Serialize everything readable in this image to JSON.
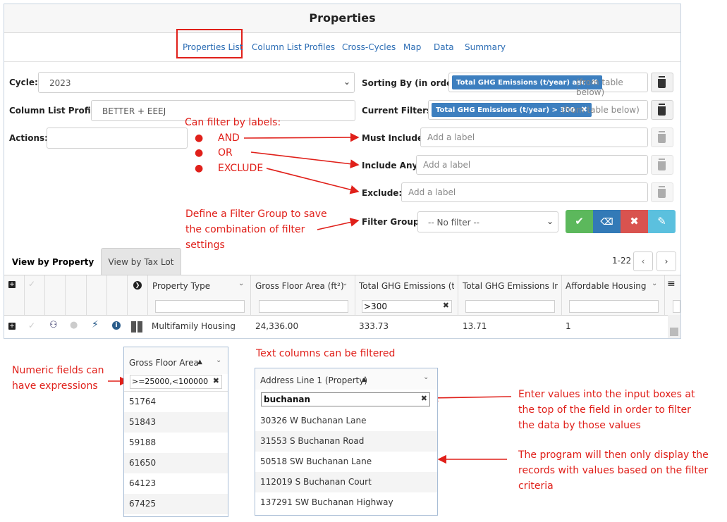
{
  "title": "Properties",
  "nav": {
    "tabs": [
      "Properties List",
      "Column List Profiles",
      "Cross-Cycles",
      "Map",
      "Data",
      "Summary"
    ]
  },
  "form": {
    "cycle_label": "Cycle:",
    "cycle_value": "2023",
    "column_profile_label": "Column List Profile:",
    "column_profile_value": "BETTER + EEEJ",
    "actions_label": "Actions:",
    "sorting_label": "Sorting By (in order):",
    "sorting_chip": "Total GHG Emissions (t/year) asc",
    "sorting_hint": "(from table below)",
    "filters_label": "Current Filters:",
    "filters_chip": "Total GHG Emissions (t/year) > 300",
    "filters_hint": "(from table below)",
    "must_include_label": "Must Include:",
    "include_any_label": "Include Any:",
    "exclude_label": "Exclude:",
    "label_placeholder": "Add a label",
    "filter_group_label": "Filter Group:",
    "filter_group_value": "-- No filter --"
  },
  "annotations": {
    "labels_title": "Can filter by labels:",
    "and": "AND",
    "or": "OR",
    "exclude": "EXCLUDE",
    "filter_group_line1": "Define a Filter Group to save",
    "filter_group_line2": "the combination of filter",
    "filter_group_line3": "settings",
    "text_columns": "Text columns can be filtered",
    "numeric_line1": "Numeric fields can",
    "numeric_line2": "have expressions",
    "enter_line1": "Enter values into the input boxes at",
    "enter_line2": "the top of the field in order to filter",
    "enter_line3": "the data by those values",
    "program_line1": "The program will then only display the",
    "program_line2": "records with values based on the filter",
    "program_line3": "criteria"
  },
  "view_tabs": [
    "View by Property",
    "View by Tax Lot"
  ],
  "pagination": "1-22",
  "grid": {
    "columns": [
      "Property Type",
      "Gross Floor Area (ft²)",
      "Total GHG Emissions (t:",
      "Total GHG Emissions In:",
      "Affordable Housing"
    ],
    "ghg_filter": ">300",
    "row": [
      "Multifamily Housing",
      "24,336.00",
      "333.73",
      "13.71",
      "1"
    ]
  },
  "popup_area": {
    "header": "Gross Floor Area",
    "filter": ">=25000,<100000",
    "values": [
      "51764",
      "51843",
      "59188",
      "61650",
      "64123",
      "67425"
    ]
  },
  "popup_address": {
    "header": "Address Line 1 (Property)",
    "filter": "buchanan",
    "values": [
      "30326 W Buchanan Lane",
      "31553 S Buchanan Road",
      "50518 SW Buchanan Lane",
      "112019 S Buchanan Court",
      "137291 SW Buchanan Highway"
    ]
  },
  "colors": {
    "accent_red": "#e0201a",
    "chip_blue": "#3d7fbf",
    "link_blue": "#2a6cb4",
    "btn_green": "#5cb85c",
    "btn_blue": "#337ab7",
    "btn_red": "#d9534f",
    "btn_cyan": "#5bc0de"
  }
}
